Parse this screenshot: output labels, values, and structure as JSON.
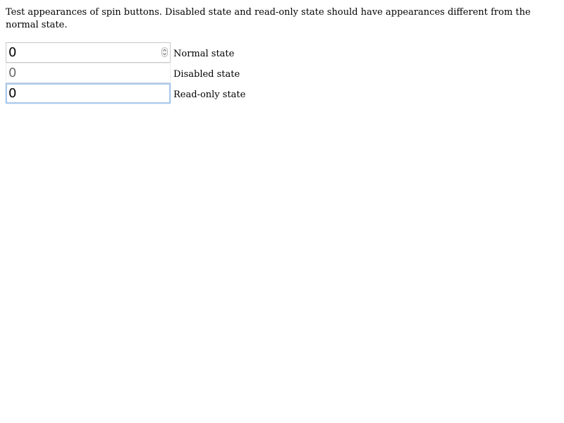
{
  "description": "Test appearances of spin buttons. Disabled state and read-only state should have appearances different from the normal state.",
  "spin_buttons": [
    {
      "value": "0",
      "label": "Normal state",
      "state": "normal",
      "has_arrows": true
    },
    {
      "value": "0",
      "label": "Disabled state",
      "state": "disabled",
      "has_arrows": false
    },
    {
      "value": "0",
      "label": "Read-only state",
      "state": "read-only",
      "has_arrows": false
    }
  ],
  "colors": {
    "normal_border": "#c8c8c8",
    "disabled_text": "#6d6d6d",
    "readonly_focus_border": "#a9c9ec"
  },
  "icons": {
    "spin_arrows": "up-down-arrows-icon"
  }
}
